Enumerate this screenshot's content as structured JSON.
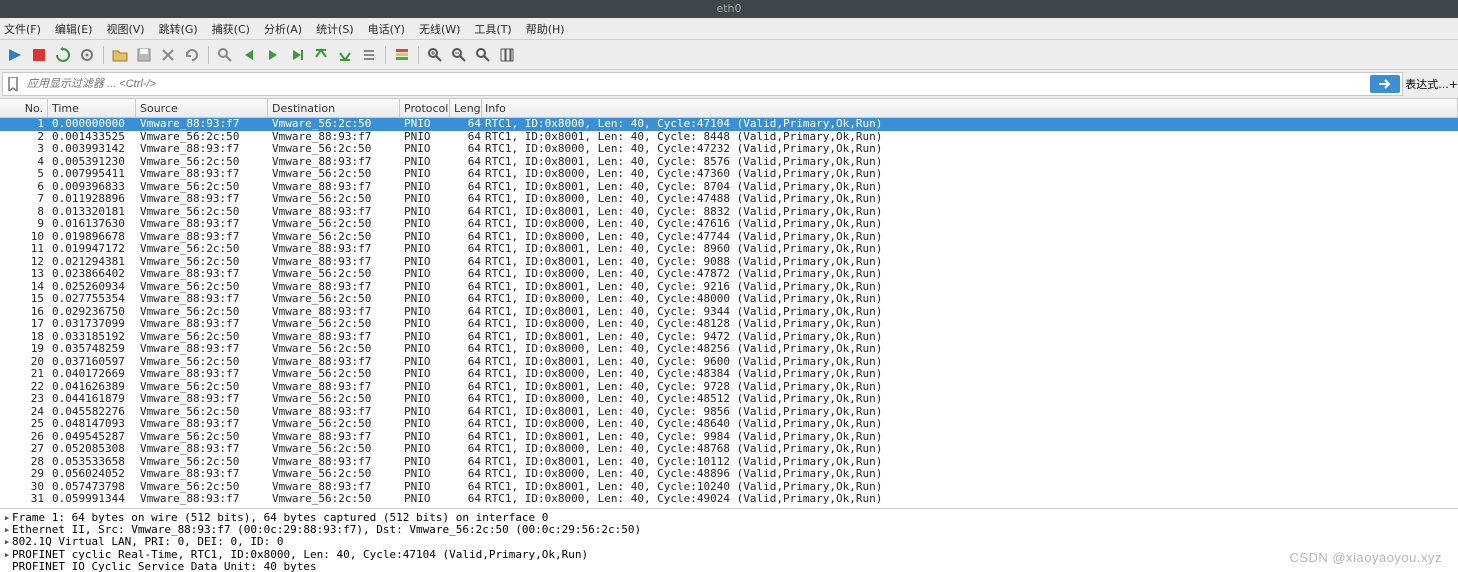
{
  "title": "eth0",
  "menu": [
    "文件(F)",
    "编辑(E)",
    "视图(V)",
    "跳转(G)",
    "捕获(C)",
    "分析(A)",
    "统计(S)",
    "电话(Y)",
    "无线(W)",
    "工具(T)",
    "帮助(H)"
  ],
  "filter_placeholder": "应用显示过滤器 ... <Ctrl-/>",
  "expr_label": "表达式...",
  "plus": "+",
  "headers": [
    "No.",
    "Time",
    "Source",
    "Destination",
    "Protocol",
    "Length",
    "Info"
  ],
  "packets": [
    {
      "no": "1",
      "time": "0.000000000",
      "src": "Vmware_88:93:f7",
      "dst": "Vmware_56:2c:50",
      "proto": "PNIO",
      "len": "64",
      "info": "RTC1, ID:0x8000, Len:  40, Cycle:47104 (Valid,Primary,Ok,Run)",
      "sel": true
    },
    {
      "no": "2",
      "time": "0.001433525",
      "src": "Vmware_56:2c:50",
      "dst": "Vmware_88:93:f7",
      "proto": "PNIO",
      "len": "64",
      "info": "RTC1, ID:0x8001, Len:  40, Cycle: 8448 (Valid,Primary,Ok,Run)"
    },
    {
      "no": "3",
      "time": "0.003993142",
      "src": "Vmware_88:93:f7",
      "dst": "Vmware_56:2c:50",
      "proto": "PNIO",
      "len": "64",
      "info": "RTC1, ID:0x8000, Len:  40, Cycle:47232 (Valid,Primary,Ok,Run)"
    },
    {
      "no": "4",
      "time": "0.005391230",
      "src": "Vmware_56:2c:50",
      "dst": "Vmware_88:93:f7",
      "proto": "PNIO",
      "len": "64",
      "info": "RTC1, ID:0x8001, Len:  40, Cycle: 8576 (Valid,Primary,Ok,Run)"
    },
    {
      "no": "5",
      "time": "0.007995411",
      "src": "Vmware_88:93:f7",
      "dst": "Vmware_56:2c:50",
      "proto": "PNIO",
      "len": "64",
      "info": "RTC1, ID:0x8000, Len:  40, Cycle:47360 (Valid,Primary,Ok,Run)"
    },
    {
      "no": "6",
      "time": "0.009396833",
      "src": "Vmware_56:2c:50",
      "dst": "Vmware_88:93:f7",
      "proto": "PNIO",
      "len": "64",
      "info": "RTC1, ID:0x8001, Len:  40, Cycle: 8704 (Valid,Primary,Ok,Run)"
    },
    {
      "no": "7",
      "time": "0.011928896",
      "src": "Vmware_88:93:f7",
      "dst": "Vmware_56:2c:50",
      "proto": "PNIO",
      "len": "64",
      "info": "RTC1, ID:0x8000, Len:  40, Cycle:47488 (Valid,Primary,Ok,Run)"
    },
    {
      "no": "8",
      "time": "0.013320181",
      "src": "Vmware_56:2c:50",
      "dst": "Vmware_88:93:f7",
      "proto": "PNIO",
      "len": "64",
      "info": "RTC1, ID:0x8001, Len:  40, Cycle: 8832 (Valid,Primary,Ok,Run)"
    },
    {
      "no": "9",
      "time": "0.016137630",
      "src": "Vmware_88:93:f7",
      "dst": "Vmware_56:2c:50",
      "proto": "PNIO",
      "len": "64",
      "info": "RTC1, ID:0x8000, Len:  40, Cycle:47616 (Valid,Primary,Ok,Run)"
    },
    {
      "no": "10",
      "time": "0.019896678",
      "src": "Vmware_88:93:f7",
      "dst": "Vmware_56:2c:50",
      "proto": "PNIO",
      "len": "64",
      "info": "RTC1, ID:0x8000, Len:  40, Cycle:47744 (Valid,Primary,Ok,Run)"
    },
    {
      "no": "11",
      "time": "0.019947172",
      "src": "Vmware_56:2c:50",
      "dst": "Vmware_88:93:f7",
      "proto": "PNIO",
      "len": "64",
      "info": "RTC1, ID:0x8001, Len:  40, Cycle: 8960 (Valid,Primary,Ok,Run)"
    },
    {
      "no": "12",
      "time": "0.021294381",
      "src": "Vmware_56:2c:50",
      "dst": "Vmware_88:93:f7",
      "proto": "PNIO",
      "len": "64",
      "info": "RTC1, ID:0x8001, Len:  40, Cycle: 9088 (Valid,Primary,Ok,Run)"
    },
    {
      "no": "13",
      "time": "0.023866402",
      "src": "Vmware_88:93:f7",
      "dst": "Vmware_56:2c:50",
      "proto": "PNIO",
      "len": "64",
      "info": "RTC1, ID:0x8000, Len:  40, Cycle:47872 (Valid,Primary,Ok,Run)"
    },
    {
      "no": "14",
      "time": "0.025260934",
      "src": "Vmware_56:2c:50",
      "dst": "Vmware_88:93:f7",
      "proto": "PNIO",
      "len": "64",
      "info": "RTC1, ID:0x8001, Len:  40, Cycle: 9216 (Valid,Primary,Ok,Run)"
    },
    {
      "no": "15",
      "time": "0.027755354",
      "src": "Vmware_88:93:f7",
      "dst": "Vmware_56:2c:50",
      "proto": "PNIO",
      "len": "64",
      "info": "RTC1, ID:0x8000, Len:  40, Cycle:48000 (Valid,Primary,Ok,Run)"
    },
    {
      "no": "16",
      "time": "0.029236750",
      "src": "Vmware_56:2c:50",
      "dst": "Vmware_88:93:f7",
      "proto": "PNIO",
      "len": "64",
      "info": "RTC1, ID:0x8001, Len:  40, Cycle: 9344 (Valid,Primary,Ok,Run)"
    },
    {
      "no": "17",
      "time": "0.031737099",
      "src": "Vmware_88:93:f7",
      "dst": "Vmware_56:2c:50",
      "proto": "PNIO",
      "len": "64",
      "info": "RTC1, ID:0x8000, Len:  40, Cycle:48128 (Valid,Primary,Ok,Run)"
    },
    {
      "no": "18",
      "time": "0.033185192",
      "src": "Vmware_56:2c:50",
      "dst": "Vmware_88:93:f7",
      "proto": "PNIO",
      "len": "64",
      "info": "RTC1, ID:0x8001, Len:  40, Cycle: 9472 (Valid,Primary,Ok,Run)"
    },
    {
      "no": "19",
      "time": "0.035748259",
      "src": "Vmware_88:93:f7",
      "dst": "Vmware_56:2c:50",
      "proto": "PNIO",
      "len": "64",
      "info": "RTC1, ID:0x8000, Len:  40, Cycle:48256 (Valid,Primary,Ok,Run)"
    },
    {
      "no": "20",
      "time": "0.037160597",
      "src": "Vmware_56:2c:50",
      "dst": "Vmware_88:93:f7",
      "proto": "PNIO",
      "len": "64",
      "info": "RTC1, ID:0x8001, Len:  40, Cycle: 9600 (Valid,Primary,Ok,Run)"
    },
    {
      "no": "21",
      "time": "0.040172669",
      "src": "Vmware_88:93:f7",
      "dst": "Vmware_56:2c:50",
      "proto": "PNIO",
      "len": "64",
      "info": "RTC1, ID:0x8000, Len:  40, Cycle:48384 (Valid,Primary,Ok,Run)"
    },
    {
      "no": "22",
      "time": "0.041626389",
      "src": "Vmware_56:2c:50",
      "dst": "Vmware_88:93:f7",
      "proto": "PNIO",
      "len": "64",
      "info": "RTC1, ID:0x8001, Len:  40, Cycle: 9728 (Valid,Primary,Ok,Run)"
    },
    {
      "no": "23",
      "time": "0.044161879",
      "src": "Vmware_88:93:f7",
      "dst": "Vmware_56:2c:50",
      "proto": "PNIO",
      "len": "64",
      "info": "RTC1, ID:0x8000, Len:  40, Cycle:48512 (Valid,Primary,Ok,Run)"
    },
    {
      "no": "24",
      "time": "0.045582276",
      "src": "Vmware_56:2c:50",
      "dst": "Vmware_88:93:f7",
      "proto": "PNIO",
      "len": "64",
      "info": "RTC1, ID:0x8001, Len:  40, Cycle: 9856 (Valid,Primary,Ok,Run)"
    },
    {
      "no": "25",
      "time": "0.048147093",
      "src": "Vmware_88:93:f7",
      "dst": "Vmware_56:2c:50",
      "proto": "PNIO",
      "len": "64",
      "info": "RTC1, ID:0x8000, Len:  40, Cycle:48640 (Valid,Primary,Ok,Run)"
    },
    {
      "no": "26",
      "time": "0.049545287",
      "src": "Vmware_56:2c:50",
      "dst": "Vmware_88:93:f7",
      "proto": "PNIO",
      "len": "64",
      "info": "RTC1, ID:0x8001, Len:  40, Cycle: 9984 (Valid,Primary,Ok,Run)"
    },
    {
      "no": "27",
      "time": "0.052085308",
      "src": "Vmware_88:93:f7",
      "dst": "Vmware_56:2c:50",
      "proto": "PNIO",
      "len": "64",
      "info": "RTC1, ID:0x8000, Len:  40, Cycle:48768 (Valid,Primary,Ok,Run)"
    },
    {
      "no": "28",
      "time": "0.053533658",
      "src": "Vmware_56:2c:50",
      "dst": "Vmware_88:93:f7",
      "proto": "PNIO",
      "len": "64",
      "info": "RTC1, ID:0x8001, Len:  40, Cycle:10112 (Valid,Primary,Ok,Run)"
    },
    {
      "no": "29",
      "time": "0.056024052",
      "src": "Vmware_88:93:f7",
      "dst": "Vmware_56:2c:50",
      "proto": "PNIO",
      "len": "64",
      "info": "RTC1, ID:0x8000, Len:  40, Cycle:48896 (Valid,Primary,Ok,Run)"
    },
    {
      "no": "30",
      "time": "0.057473798",
      "src": "Vmware_56:2c:50",
      "dst": "Vmware_88:93:f7",
      "proto": "PNIO",
      "len": "64",
      "info": "RTC1, ID:0x8001, Len:  40, Cycle:10240 (Valid,Primary,Ok,Run)"
    },
    {
      "no": "31",
      "time": "0.059991344",
      "src": "Vmware_88:93:f7",
      "dst": "Vmware_56:2c:50",
      "proto": "PNIO",
      "len": "64",
      "info": "RTC1, ID:0x8000, Len:  40, Cycle:49024 (Valid,Primary,Ok,Run)"
    }
  ],
  "details": [
    {
      "exp": true,
      "txt": "Frame 1: 64 bytes on wire (512 bits), 64 bytes captured (512 bits) on interface 0"
    },
    {
      "exp": true,
      "txt": "Ethernet II, Src: Vmware_88:93:f7 (00:0c:29:88:93:f7), Dst: Vmware_56:2c:50 (00:0c:29:56:2c:50)"
    },
    {
      "exp": true,
      "txt": "802.1Q Virtual LAN, PRI: 0, DEI: 0, ID: 0"
    },
    {
      "exp": true,
      "txt": "PROFINET cyclic Real-Time, RTC1, ID:0x8000, Len:  40, Cycle:47104 (Valid,Primary,Ok,Run)"
    },
    {
      "exp": false,
      "txt": "PROFINET IO Cyclic Service Data Unit: 40 bytes"
    }
  ],
  "watermark": "CSDN @xiaoyaoyou.xyz"
}
